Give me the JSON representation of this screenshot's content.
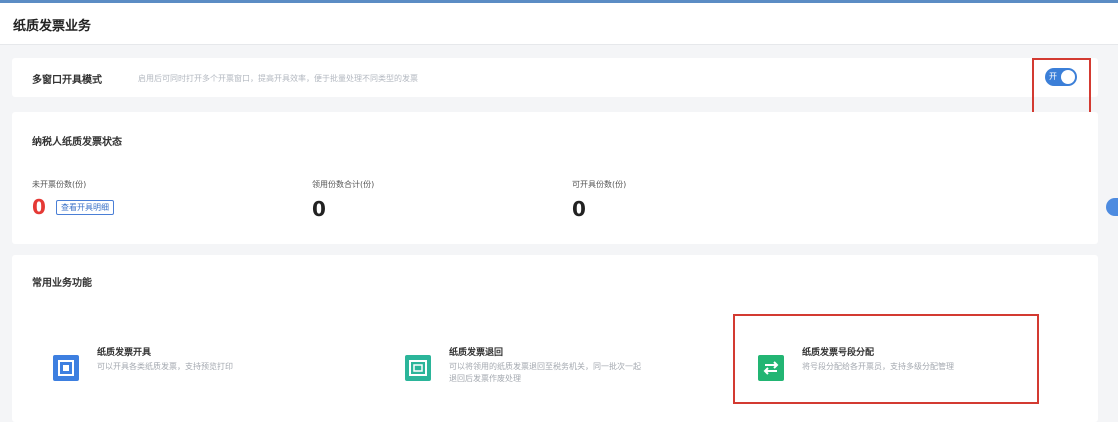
{
  "page": {
    "title": "纸质发票业务"
  },
  "multi_window": {
    "label": "多窗口开具模式",
    "description": "启用后可同时打开多个开票窗口，提高开具效率，便于批量处理不同类型的发票",
    "toggle_label": "开",
    "enabled": true
  },
  "ticket_status": {
    "title": "纳税人纸质发票状态",
    "stats": [
      {
        "label": "未开票份数(份)",
        "value": "0",
        "link": "查看开具明细"
      },
      {
        "label": "领用份数合计(份)",
        "value": "0"
      },
      {
        "label": "可开具份数(份)",
        "value": "0"
      }
    ]
  },
  "functions": {
    "title": "常用业务功能",
    "items": [
      {
        "name": "纸质发票开具",
        "desc": "可以开具各类纸质发票，支持预览打印",
        "icon": "invoice-issue-icon",
        "color": "#3d7fe0"
      },
      {
        "name": "纸质发票退回",
        "desc": [
          "可以将领用的纸质发票退回至税务机关，同一批次一起",
          "退回后发票作废处理"
        ],
        "icon": "invoice-return-icon",
        "color": "#2bb59a"
      },
      {
        "name": "纸质发票号段分配",
        "desc": "将号段分配给各开票员，支持多级分配管理",
        "icon": "transfer-arrows-icon",
        "color": "#22b573"
      }
    ]
  },
  "colors": {
    "accent": "#3b7fd8",
    "alert": "#e53935",
    "highlight": "#d33a31"
  }
}
